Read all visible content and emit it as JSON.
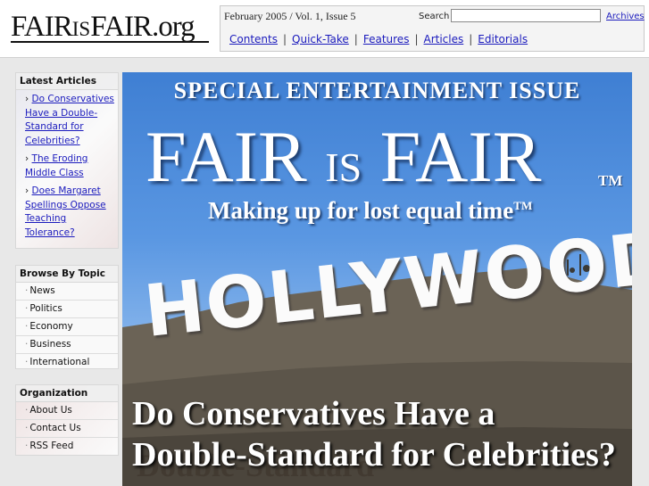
{
  "header": {
    "logo_main": "FAIR",
    "logo_mid": "IS",
    "logo_end": "FAIR.org",
    "issue_line": "February 2005 / Vol. 1, Issue 5",
    "search_label": "Search",
    "search_value": "",
    "archives_label": "Archives",
    "nav": [
      {
        "label": "Contents"
      },
      {
        "label": "Quick-Take"
      },
      {
        "label": "Features"
      },
      {
        "label": "Articles"
      },
      {
        "label": "Editorials"
      }
    ],
    "nav_separator": "|"
  },
  "sidebar": {
    "latest": {
      "title": "Latest Articles",
      "items": [
        {
          "label": "Do Conservatives Have a Double-Standard for Celebrities?"
        },
        {
          "label": "The Eroding Middle Class"
        },
        {
          "label": "Does Margaret Spellings Oppose Teaching Tolerance?"
        }
      ],
      "bullet": "›"
    },
    "topics": {
      "title": "Browse By Topic",
      "items": [
        {
          "label": "News"
        },
        {
          "label": "Politics"
        },
        {
          "label": "Economy"
        },
        {
          "label": "Business"
        },
        {
          "label": "International"
        }
      ]
    },
    "organization": {
      "title": "Organization",
      "items": [
        {
          "label": "About Us"
        },
        {
          "label": "Contact Us"
        },
        {
          "label": "RSS Feed"
        }
      ]
    },
    "list_bullet": "·"
  },
  "hero": {
    "special": "SPECIAL ENTERTAINMENT ISSUE",
    "title_a": "FAIR ",
    "title_is": "IS",
    "title_b": " FAIR",
    "tm": "TM",
    "tagline": "Making up for lost equal time",
    "tagline_tm": "TM",
    "sign": "HOLLYWOOD",
    "headline_line1": "Do Conservatives Have a",
    "headline_line2": "Double-Standard for Celebrities?",
    "ghost_text": "Double-Standard"
  },
  "colors": {
    "link": "#1b1bbd",
    "sky_top": "#3f7fd3",
    "hill": "#5c554a"
  }
}
